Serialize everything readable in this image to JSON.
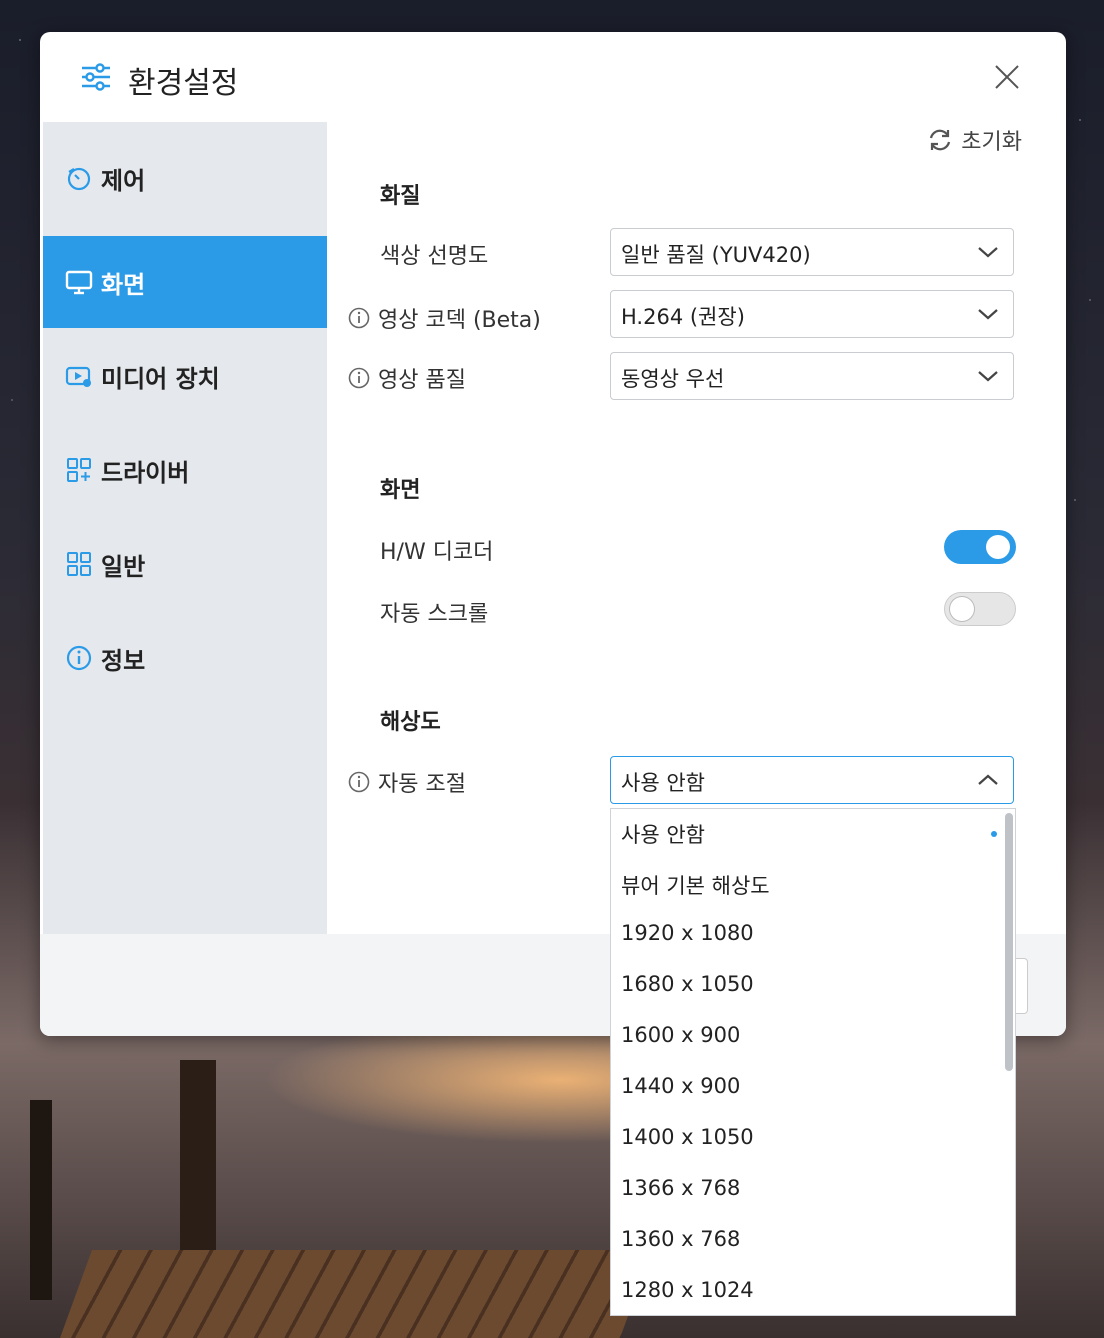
{
  "dialog": {
    "title": "환경설정",
    "reset_label": "초기화"
  },
  "sidebar": {
    "items": [
      {
        "label": "제어",
        "icon": "control-icon",
        "active": false
      },
      {
        "label": "화면",
        "icon": "monitor-icon",
        "active": true
      },
      {
        "label": "미디어 장치",
        "icon": "media-device-icon",
        "active": false
      },
      {
        "label": "드라이버",
        "icon": "driver-icon",
        "active": false
      },
      {
        "label": "일반",
        "icon": "grid-icon",
        "active": false
      },
      {
        "label": "정보",
        "icon": "info-icon",
        "active": false
      }
    ]
  },
  "quality": {
    "title": "화질",
    "color_clarity": {
      "label": "색상 선명도",
      "value": "일반 품질 (YUV420)"
    },
    "video_codec": {
      "label": "영상 코덱 (Beta)",
      "value": "H.264 (권장)"
    },
    "video_quality": {
      "label": "영상 품질",
      "value": "동영상 우선"
    }
  },
  "screen": {
    "title": "화면",
    "hw_decoder": {
      "label": "H/W 디코더",
      "on": true
    },
    "auto_scroll": {
      "label": "자동 스크롤",
      "on": false
    }
  },
  "resolution": {
    "title": "해상도",
    "auto_adjust": {
      "label": "자동 조절",
      "value": "사용 안함"
    },
    "options": [
      "사용 안함",
      "뷰어 기본 해상도",
      "1920 x 1080",
      "1680 x 1050",
      "1600 x 900",
      "1440 x 900",
      "1400 x 1050",
      "1366 x 768",
      "1360 x 768",
      "1280 x 1024"
    ],
    "selected_index": 0
  },
  "colors": {
    "accent": "#2b9be8",
    "sidebar_bg": "#e5e9ed"
  }
}
